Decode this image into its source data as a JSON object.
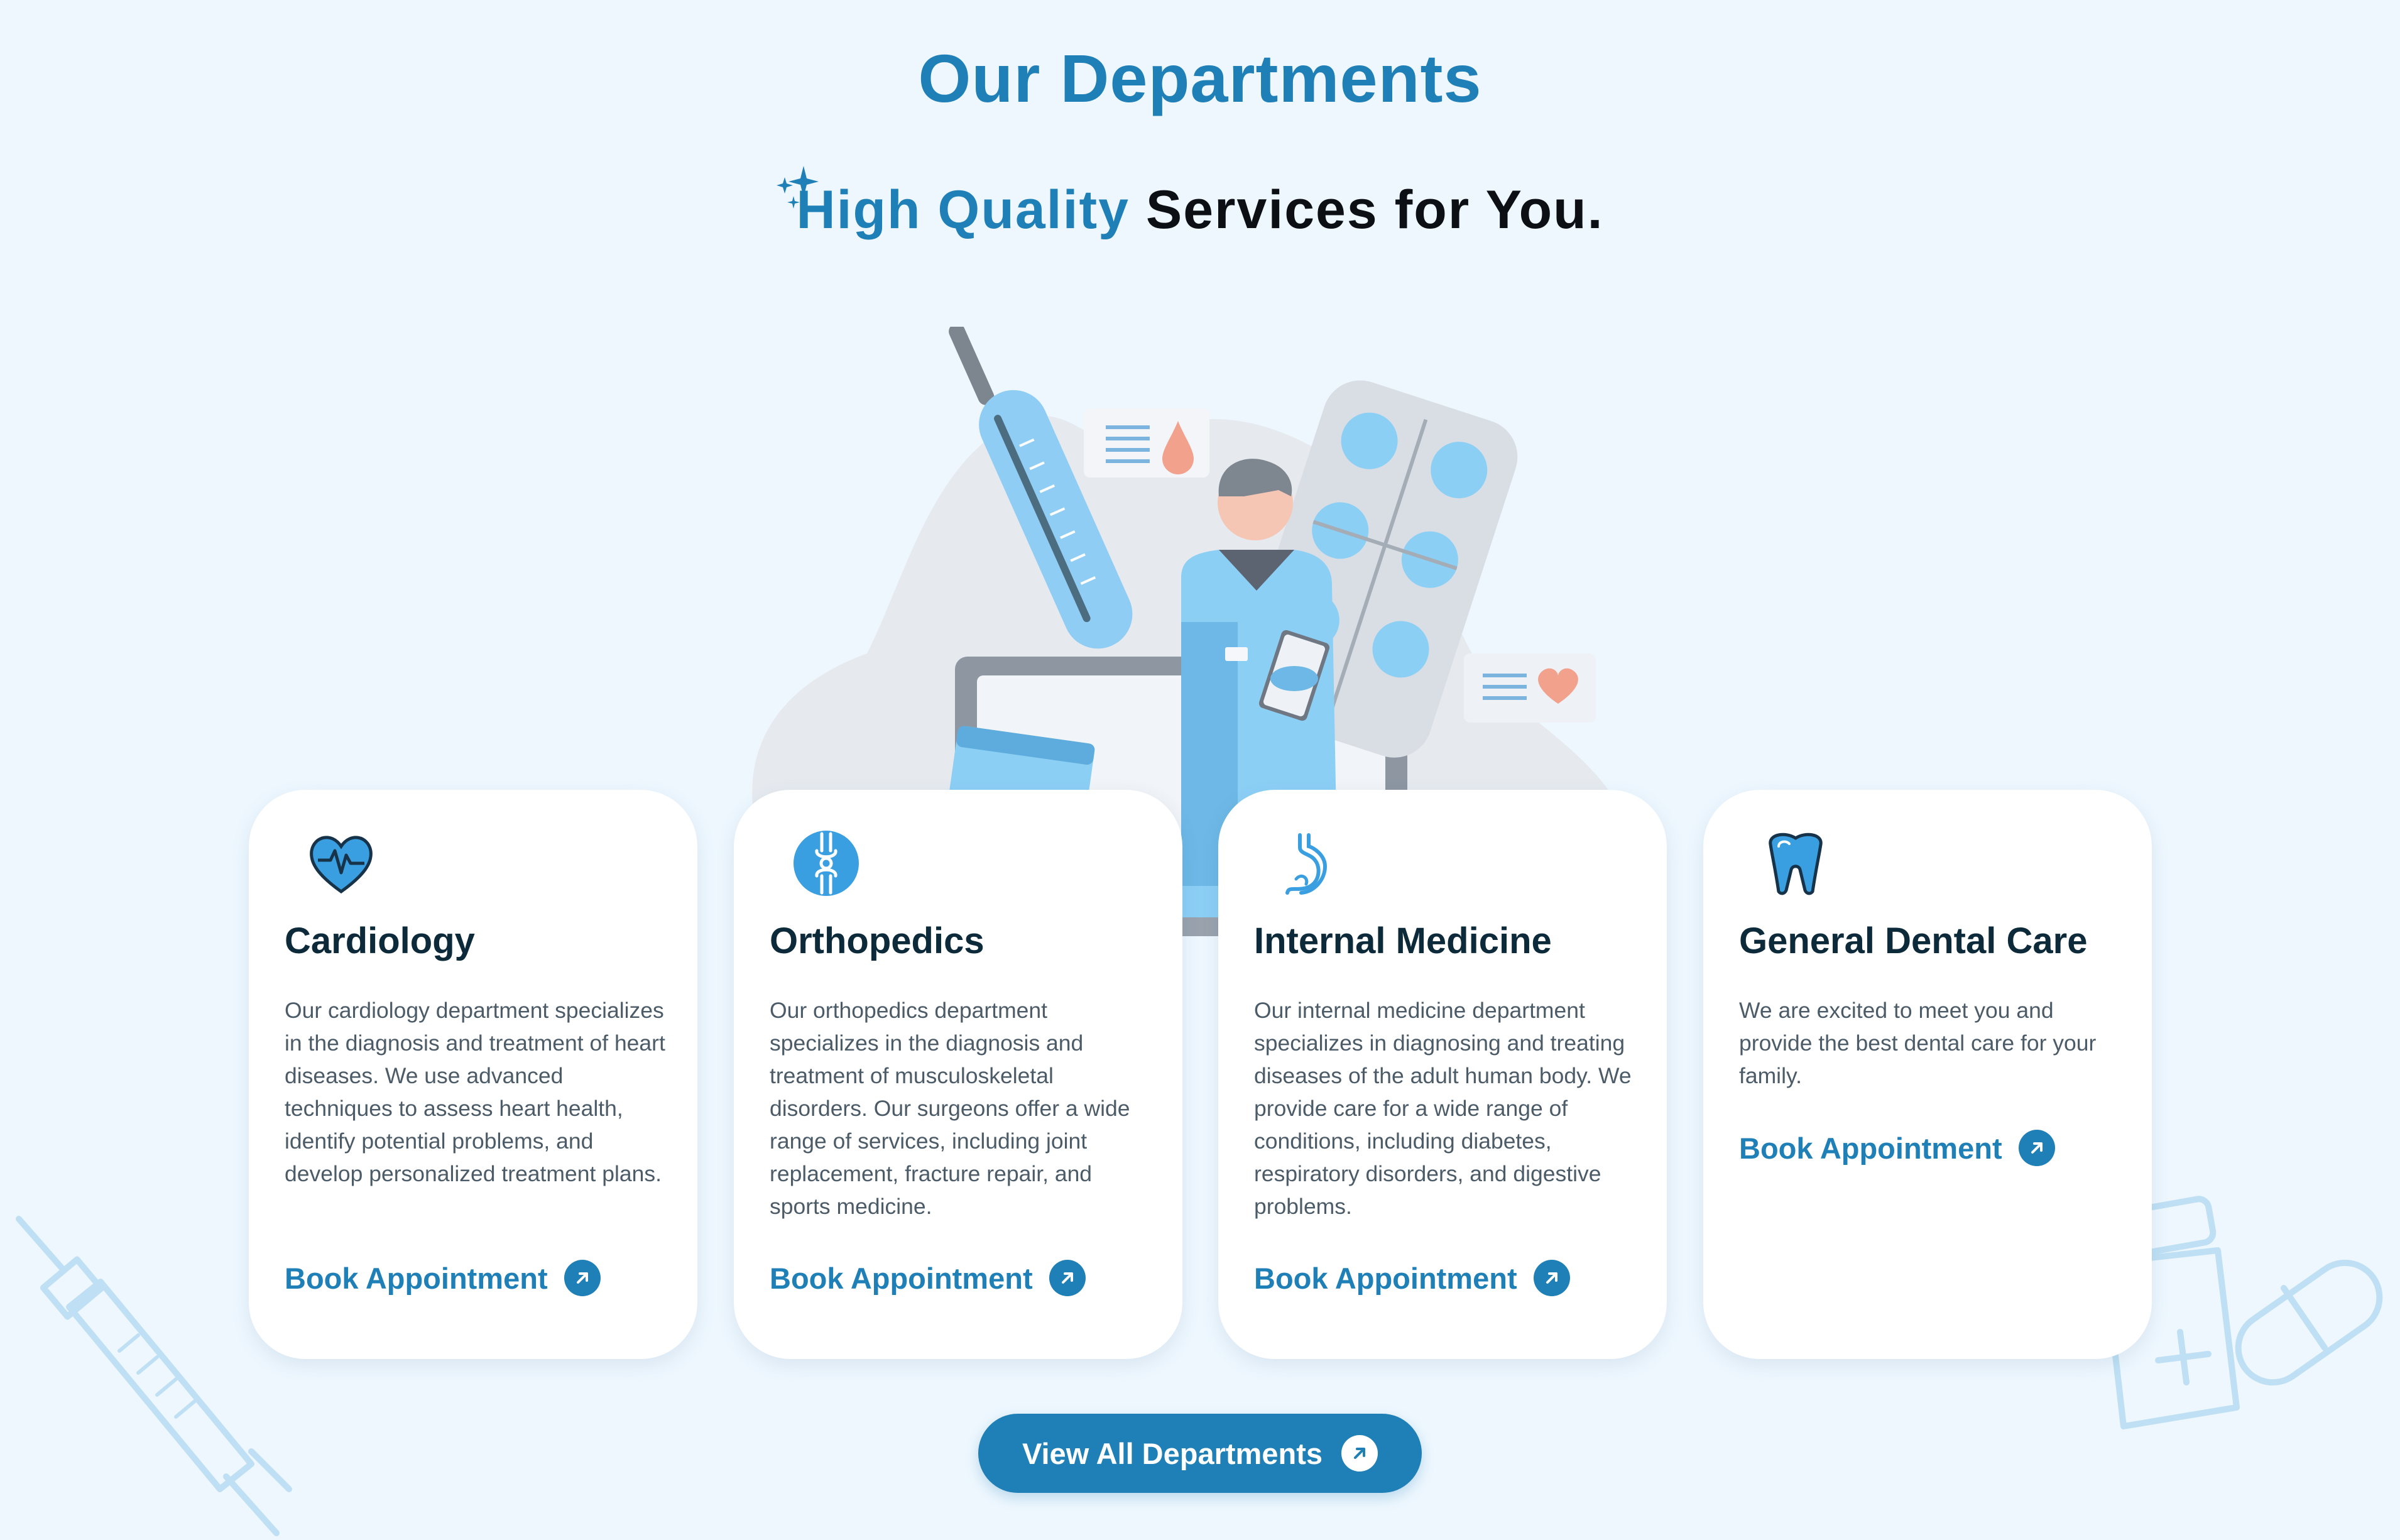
{
  "header": {
    "title": "Our Departments",
    "subtitle_highlight": "High Quality",
    "subtitle_rest": "Services for You."
  },
  "departments": [
    {
      "title": "Cardiology",
      "description": "Our cardiology department specializes in the diagnosis and treatment of heart diseases. We use advanced techniques to assess heart health, identify potential problems, and develop personalized treatment plans.",
      "link_label": "Book Appointment",
      "icon": "heart-pulse-icon"
    },
    {
      "title": "Orthopedics",
      "description": "Our orthopedics department specializes in the diagnosis and treatment of musculoskeletal disorders. Our surgeons offer a wide range of services, including joint replacement, fracture repair, and sports medicine.",
      "link_label": "Book Appointment",
      "icon": "bone-joint-icon"
    },
    {
      "title": "Internal Medicine",
      "description": "Our internal medicine department specializes in diagnosing and treating diseases of the adult human body. We provide care for a wide range of conditions, including diabetes, respiratory disorders, and digestive problems.",
      "link_label": "Book Appointment",
      "icon": "stomach-icon"
    },
    {
      "title": "General Dental Care",
      "description": "We are excited to meet you and provide the best dental care for your family.",
      "link_label": "Book Appointment",
      "icon": "tooth-icon"
    }
  ],
  "view_all_label": "View All Departments",
  "colors": {
    "accent": "#1f7fb7",
    "background": "#eef7fe",
    "card": "#ffffff",
    "heading": "#0c2a3a"
  }
}
